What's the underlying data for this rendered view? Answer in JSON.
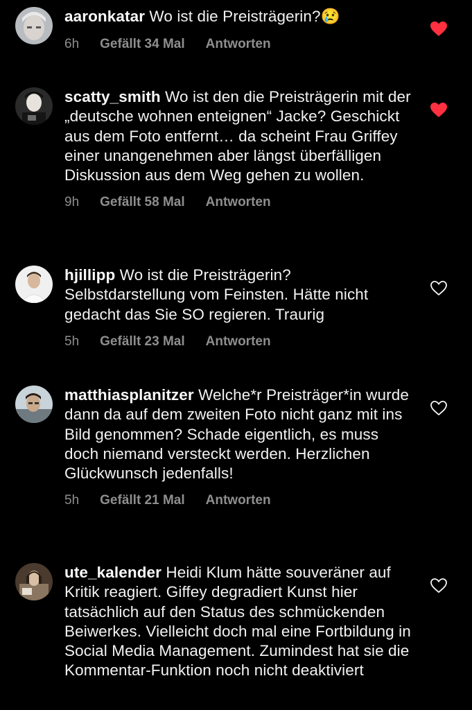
{
  "accent": {
    "heart_red": "#ff3040",
    "meta_gray": "#8e8e8e"
  },
  "comments": [
    {
      "username": "aaronkatar",
      "text": "Wo ist die Preisträgerin?",
      "emoji": "😢",
      "time": "6h",
      "likes": "Gefällt 34 Mal",
      "reply": "Antworten",
      "liked": true
    },
    {
      "username": "scatty_smith",
      "text": "Wo ist den die Preisträgerin mit der „deutsche wohnen enteignen“ Jacke? Geschickt aus dem Foto entfernt… da scheint Frau Griffey einer unangenehmen aber längst überfälligen Diskussion aus dem Weg gehen zu wollen.",
      "time": "9h",
      "likes": "Gefällt 58 Mal",
      "reply": "Antworten",
      "liked": true
    },
    {
      "username": "hjillipp",
      "text": "Wo ist die Preisträgerin? Selbstdarstellung vom Feinsten. Hätte nicht gedacht das Sie SO regieren. Traurig",
      "time": "5h",
      "likes": "Gefällt 23 Mal",
      "reply": "Antworten",
      "liked": false
    },
    {
      "username": "matthiasplanitzer",
      "text": "Welche*r Preisträger*in wurde dann da auf dem zweiten Foto nicht ganz mit ins Bild genommen? Schade eigentlich, es muss doch niemand versteckt werden. Herzlichen Glückwunsch jedenfalls!",
      "time": "5h",
      "likes": "Gefällt 21 Mal",
      "reply": "Antworten",
      "liked": false
    },
    {
      "username": "ute_kalender",
      "text": "Heidi Klum hätte souveräner auf Kritik reagiert. Giffey degradiert Kunst hier tatsächlich auf den Status des schmückenden Beiwerkes. Vielleicht doch mal eine Fortbildung in Social Media Management. Zumindest hat sie die Kommentar-Funktion noch nicht deaktiviert",
      "liked": false
    }
  ]
}
